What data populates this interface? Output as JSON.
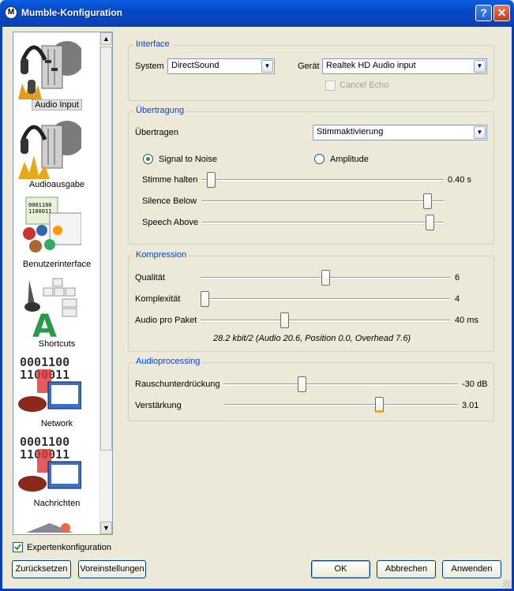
{
  "window": {
    "title": "Mumble-Konfiguration"
  },
  "sidebar": {
    "items": [
      {
        "label": "Audio Input",
        "icon": "audio-input-icon"
      },
      {
        "label": "Audioausgabe",
        "icon": "audio-output-icon"
      },
      {
        "label": "Benutzerinterface",
        "icon": "user-interface-icon"
      },
      {
        "label": "Shortcuts",
        "icon": "shortcuts-icon"
      },
      {
        "label": "Network",
        "icon": "network-icon"
      },
      {
        "label": "Nachrichten",
        "icon": "messages-icon"
      }
    ],
    "selected": "Audio Input"
  },
  "interface": {
    "title": "Interface",
    "system_label": "System",
    "system_value": "DirectSound",
    "device_label": "Gerät",
    "device_value": "Realtek HD Audio input",
    "cancel_echo_label": "Cancel Echo"
  },
  "transmission": {
    "title": "Übertragung",
    "transmit_label": "Übertragen",
    "transmit_value": "Stimmaktivierung",
    "signal_to_noise_label": "Signal to Noise",
    "amplitude_label": "Amplitude",
    "hold_label": "Stimme halten",
    "hold_value": "0.40 s",
    "hold_level": 0.02,
    "silence_below_label": "Silence Below",
    "silence_below_level": 0.95,
    "speech_above_label": "Speech Above",
    "speech_above_level": 0.96
  },
  "compression": {
    "title": "Kompression",
    "quality_label": "Qualität",
    "quality_value": "6",
    "quality_level": 0.5,
    "complexity_label": "Komplexität",
    "complexity_value": "4",
    "complexity_level": 0.0,
    "packet_label": "Audio pro Paket",
    "packet_value": "40 ms",
    "packet_level": 0.33,
    "stats": "28.2 kbit/2 (Audio 20.6, Position 0.0, Overhead 7.6)"
  },
  "processing": {
    "title": "Audioprocessing",
    "noise_label": "Rauschunterdrückung",
    "noise_value": "-30 dB",
    "noise_level": 0.33,
    "amp_label": "Verstärkung",
    "amp_value": "3.01",
    "amp_level": 0.67
  },
  "footer": {
    "expert_label": "Expertenkonfiguration",
    "reset": "Zurücksetzen",
    "defaults": "Voreinstellungen",
    "ok": "OK",
    "cancel": "Abbrechen",
    "apply": "Anwenden"
  }
}
